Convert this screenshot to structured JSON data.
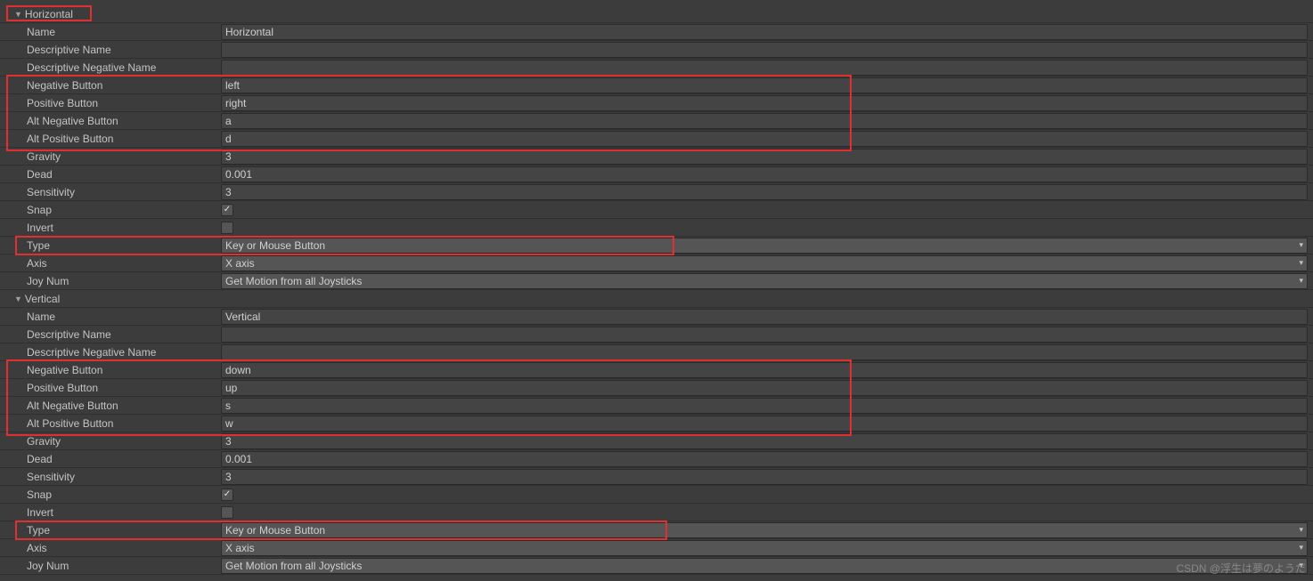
{
  "axes": [
    {
      "header": "Horizontal",
      "fields": {
        "name_label": "Name",
        "name_value": "Horizontal",
        "descname_label": "Descriptive Name",
        "descname_value": "",
        "descnegname_label": "Descriptive Negative Name",
        "descnegname_value": "",
        "negbtn_label": "Negative Button",
        "negbtn_value": "left",
        "posbtn_label": "Positive Button",
        "posbtn_value": "right",
        "altneg_label": "Alt Negative Button",
        "altneg_value": "a",
        "altpos_label": "Alt Positive Button",
        "altpos_value": "d",
        "gravity_label": "Gravity",
        "gravity_value": "3",
        "dead_label": "Dead",
        "dead_value": "0.001",
        "sensitivity_label": "Sensitivity",
        "sensitivity_value": "3",
        "snap_label": "Snap",
        "snap_value": true,
        "invert_label": "Invert",
        "invert_value": false,
        "type_label": "Type",
        "type_value": "Key or Mouse Button",
        "axis_label": "Axis",
        "axis_value": "X axis",
        "joynum_label": "Joy Num",
        "joynum_value": "Get Motion from all Joysticks"
      }
    },
    {
      "header": "Vertical",
      "fields": {
        "name_label": "Name",
        "name_value": "Vertical",
        "descname_label": "Descriptive Name",
        "descname_value": "",
        "descnegname_label": "Descriptive Negative Name",
        "descnegname_value": "",
        "negbtn_label": "Negative Button",
        "negbtn_value": "down",
        "posbtn_label": "Positive Button",
        "posbtn_value": "up",
        "altneg_label": "Alt Negative Button",
        "altneg_value": "s",
        "altpos_label": "Alt Positive Button",
        "altpos_value": "w",
        "gravity_label": "Gravity",
        "gravity_value": "3",
        "dead_label": "Dead",
        "dead_value": "0.001",
        "sensitivity_label": "Sensitivity",
        "sensitivity_value": "3",
        "snap_label": "Snap",
        "snap_value": true,
        "invert_label": "Invert",
        "invert_value": false,
        "type_label": "Type",
        "type_value": "Key or Mouse Button",
        "axis_label": "Axis",
        "axis_value": "X axis",
        "joynum_label": "Joy Num",
        "joynum_value": "Get Motion from all Joysticks"
      }
    }
  ],
  "watermark": "CSDN @浮生は夢のようだ"
}
